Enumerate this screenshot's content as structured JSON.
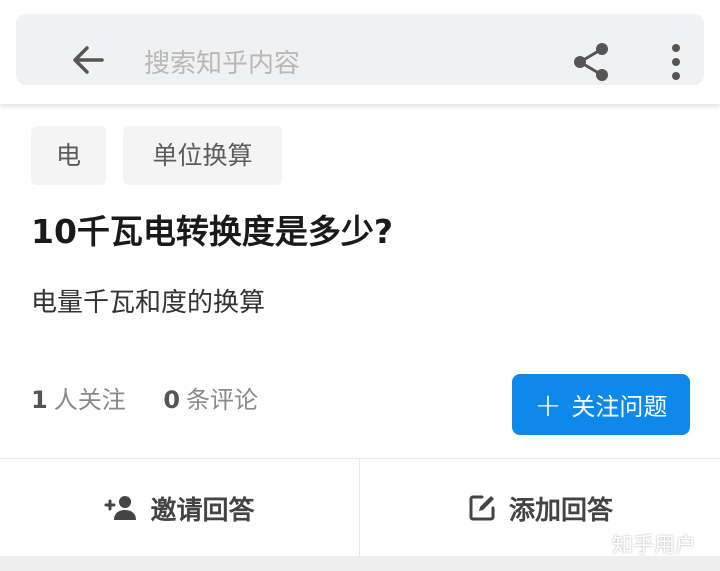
{
  "search": {
    "placeholder": "搜索知乎内容"
  },
  "icons": {
    "back": "arrow-left-icon",
    "share": "share-icon",
    "more": "more-vertical-icon",
    "invite": "person-add-icon",
    "add_answer": "edit-icon"
  },
  "tags": [
    "电",
    "单位换算"
  ],
  "question": {
    "title": "10千瓦电转换度是多少?",
    "description": "电量千瓦和度的换算"
  },
  "stats": {
    "followers_count": "1",
    "followers_label": "人关注",
    "comments_count": "0",
    "comments_label": "条评论"
  },
  "follow_button": {
    "label": "关注问题",
    "color": "#0f88eb"
  },
  "actions": {
    "invite_label": "邀请回答",
    "add_answer_label": "添加回答"
  },
  "watermark": "知乎用户"
}
